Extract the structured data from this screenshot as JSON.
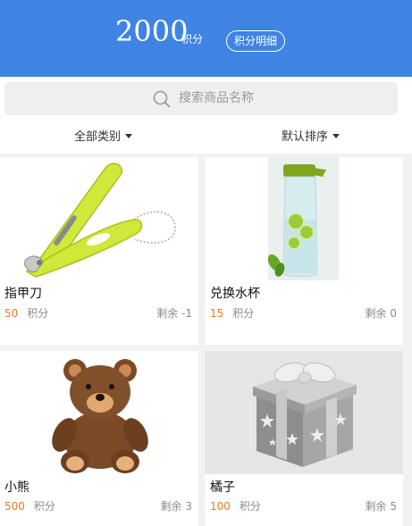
{
  "header": {
    "points": "2000",
    "points_unit": "积分",
    "detail_button": "积分明细"
  },
  "search": {
    "placeholder": "搜索商品名称"
  },
  "filters": {
    "category": "全部类别",
    "sort": "默认排序"
  },
  "products": [
    {
      "name": "指甲刀",
      "price": "50",
      "unit": "积分",
      "stock": "剩余 -1",
      "image": "nail-clipper"
    },
    {
      "name": "兑换水杯",
      "price": "15",
      "unit": "积分",
      "stock": "剩余 0",
      "image": "water-bottle"
    },
    {
      "name": "小熊",
      "price": "500",
      "unit": "积分",
      "stock": "剩余 3",
      "image": "teddy-bear"
    },
    {
      "name": "橘子",
      "price": "100",
      "unit": "积分",
      "stock": "剩余 5",
      "image": "gift-box"
    }
  ],
  "colors": {
    "header_bg": "#3f84e3",
    "price": "#e8772e",
    "page_bg": "#f2f2f2"
  }
}
